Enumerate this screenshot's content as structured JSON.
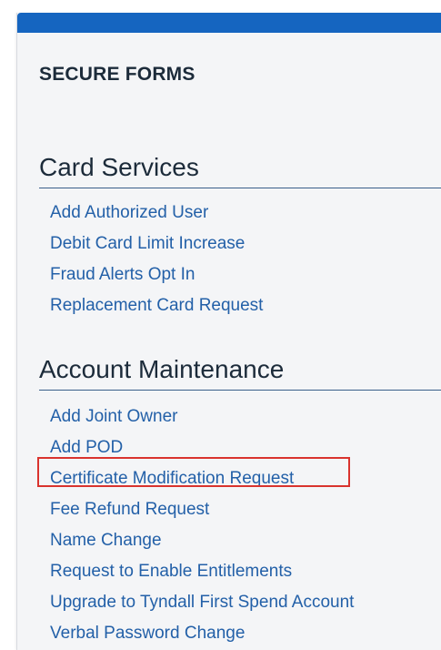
{
  "secure_forms": {
    "title": "SECURE FORMS"
  },
  "card_services": {
    "heading": "Card Services",
    "links": [
      {
        "label": "Add Authorized User"
      },
      {
        "label": "Debit Card Limit Increase"
      },
      {
        "label": "Fraud Alerts Opt In"
      },
      {
        "label": "Replacement Card Request"
      }
    ]
  },
  "account_maintenance": {
    "heading": "Account Maintenance",
    "links": [
      {
        "label": "Add Joint Owner"
      },
      {
        "label": "Add POD"
      },
      {
        "label": "Certificate Modification Request"
      },
      {
        "label": "Fee Refund Request"
      },
      {
        "label": "Name Change"
      },
      {
        "label": "Request to Enable Entitlements"
      },
      {
        "label": "Upgrade to Tyndall First Spend Account"
      },
      {
        "label": "Verbal Password Change"
      }
    ]
  },
  "colors": {
    "bar": "#1565c0",
    "link": "#2360a8",
    "heading": "#1c2b3a",
    "highlight": "#d9332e"
  }
}
